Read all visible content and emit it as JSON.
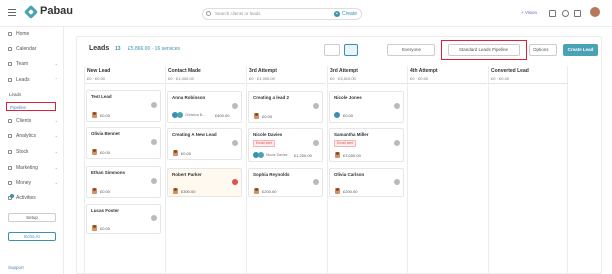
{
  "brand": {
    "name": "Pabau"
  },
  "topbar": {
    "search_placeholder": "Search clients or leads",
    "create_label": "Create",
    "vision_label": "+ Vision"
  },
  "sidebar": {
    "items": [
      {
        "label": "Home",
        "name": "home"
      },
      {
        "label": "Calendar",
        "name": "calendar"
      },
      {
        "label": "Team",
        "name": "team"
      },
      {
        "label": "Leads",
        "name": "leads"
      },
      {
        "label": "Clients",
        "name": "clients"
      },
      {
        "label": "Analytics",
        "name": "analytics"
      },
      {
        "label": "Stock",
        "name": "stock"
      },
      {
        "label": "Marketing",
        "name": "marketing"
      },
      {
        "label": "Money",
        "name": "money"
      },
      {
        "label": "Activities",
        "name": "activities"
      }
    ],
    "leads_sub": {
      "leads": "Leads",
      "pipeline": "Pipeline"
    },
    "setup_label": "Setup",
    "echo_label": "Echo AI",
    "support_label": "Support"
  },
  "board": {
    "title": "Leads",
    "count": "13",
    "summary": "£5,866.00 · 16 services",
    "filter_everyone": "Everyone",
    "pipeline_select": "Standard Leads Pipeline",
    "options_label": "Options",
    "create_lead_label": "Create Lead"
  },
  "columns": [
    {
      "title": "New Lead",
      "sum": "£0 · £0.00"
    },
    {
      "title": "Contact Made",
      "sum": "£0 · £1,000.00"
    },
    {
      "title": "3rd Attempt",
      "sum": "£0 · £1,000.00"
    },
    {
      "title": "3rd Attempt",
      "sum": "£0 · £3,510.00"
    },
    {
      "title": "4th Attempt",
      "sum": "£0 · £0.00"
    },
    {
      "title": "Converted Lead",
      "sum": "£0 · £0.00"
    }
  ],
  "cards": {
    "c0": [
      {
        "name": "Test Lead",
        "amount": "£0.00"
      },
      {
        "name": "Olivia Bennet",
        "amount": "£0.00"
      },
      {
        "name": "Ethan Simmons",
        "amount": "£0.00"
      },
      {
        "name": "Lucas Foster",
        "amount": "£0.00"
      }
    ],
    "c1": [
      {
        "name": "Anna Robinson",
        "people": "Christina B...",
        "amount": "£400.00"
      },
      {
        "name": "Creating A New Lead",
        "amount": "£0.00"
      },
      {
        "name": "Robert Parker",
        "amount": "£300.00"
      }
    ],
    "c2": [
      {
        "name": "Creating a lead 2",
        "amount": "£0.00"
      },
      {
        "name": "Nicole Davies",
        "tag": "Email sent",
        "people": "Nicole Davies",
        "amount": "£1,200.00"
      },
      {
        "name": "Sophia Reynolds",
        "amount": "£200.00"
      }
    ],
    "c3": [
      {
        "name": "Nicole Jones",
        "amount": "£0.00"
      },
      {
        "name": "Samantha Miller",
        "tag": "Email sent",
        "amount": "£3,000.00"
      },
      {
        "name": "Olivia Carlson",
        "amount": "£200.00"
      }
    ]
  },
  "colors": {
    "accent": "#3b8fb0",
    "highlight": "#e0203a"
  }
}
